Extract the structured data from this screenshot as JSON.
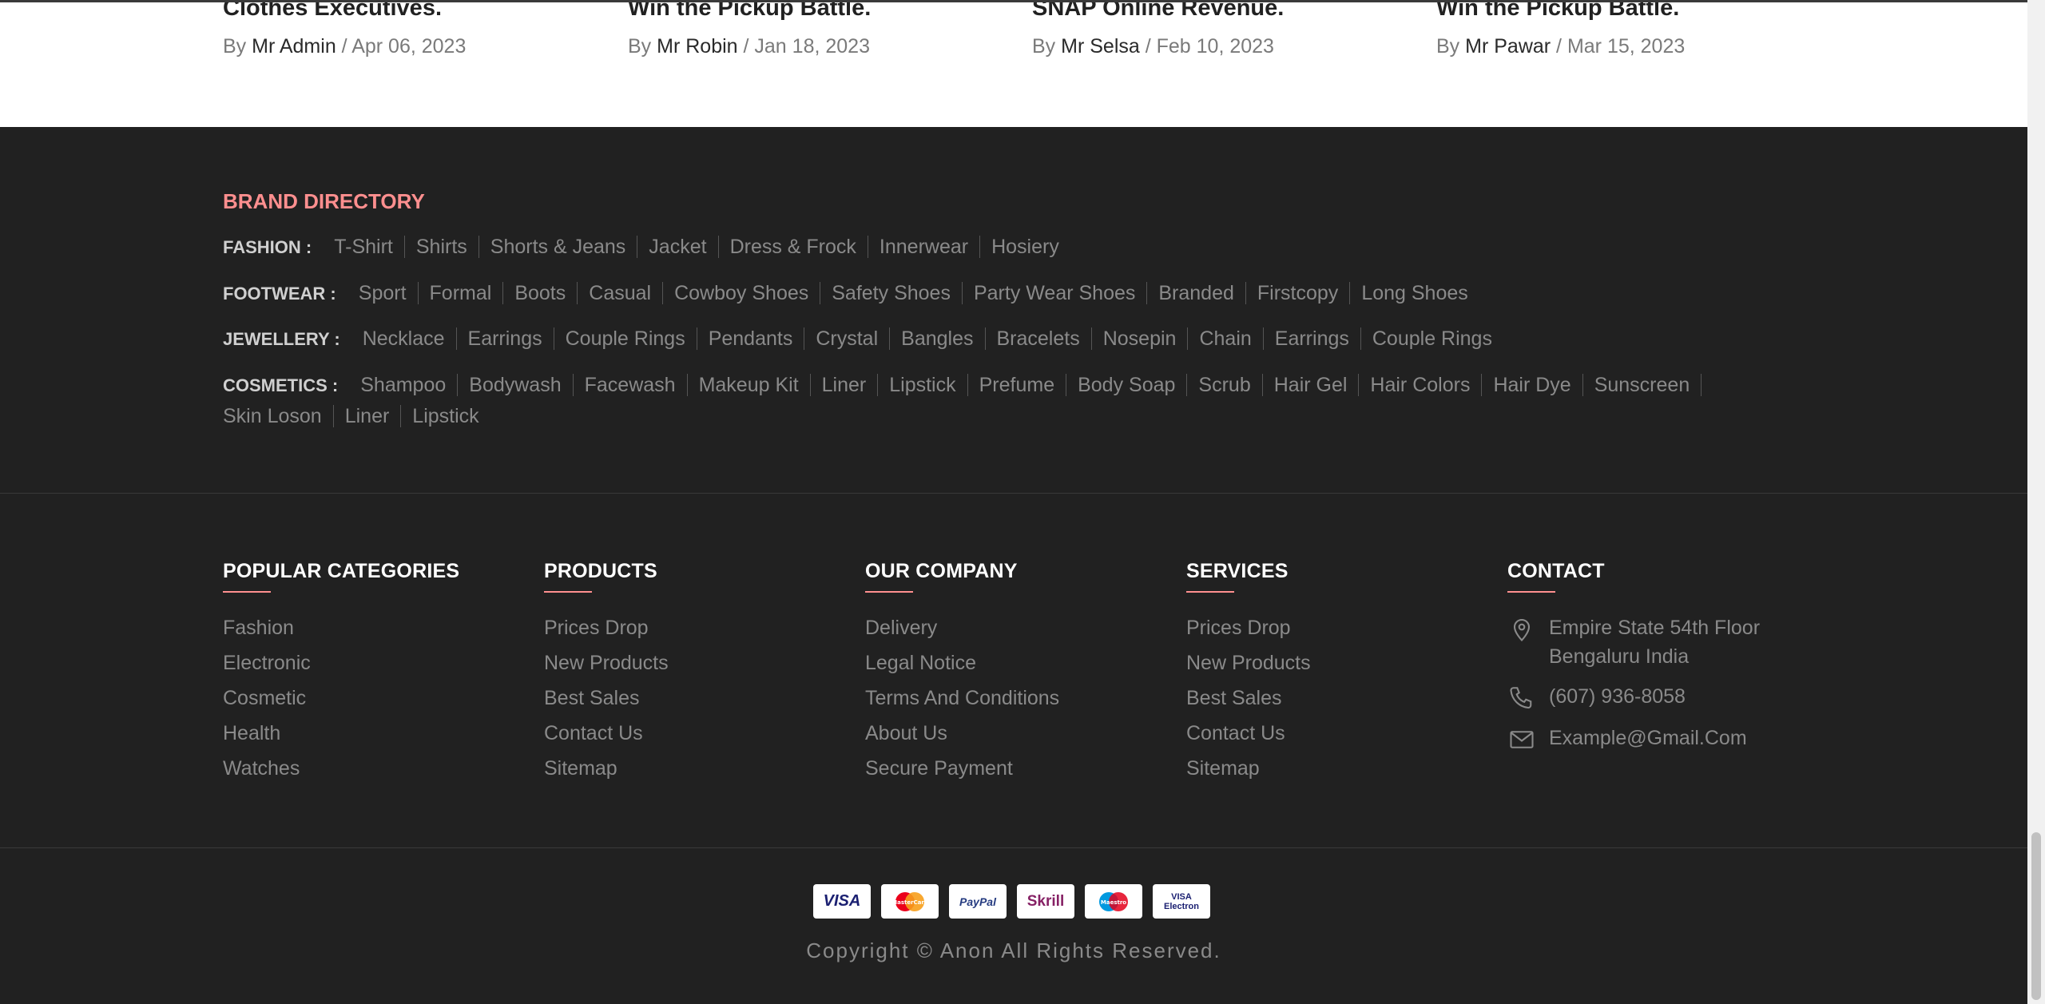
{
  "blog_posts": [
    {
      "title": "Clothes Executives.",
      "by": "By",
      "author": "Mr Admin",
      "date": "Apr 06, 2023"
    },
    {
      "title": "Win the Pickup Battle.",
      "by": "By",
      "author": "Mr Robin",
      "date": "Jan 18, 2023"
    },
    {
      "title": "SNAP Online Revenue.",
      "by": "By",
      "author": "Mr Selsa",
      "date": "Feb 10, 2023"
    },
    {
      "title": "Win the Pickup Battle.",
      "by": "By",
      "author": "Mr Pawar",
      "date": "Mar 15, 2023"
    }
  ],
  "brand_directory": {
    "title": "BRAND DIRECTORY",
    "rows": [
      {
        "category": "FASHION :",
        "links": [
          "T-Shirt",
          "Shirts",
          "Shorts & Jeans",
          "Jacket",
          "Dress & Frock",
          "Innerwear",
          "Hosiery"
        ]
      },
      {
        "category": "FOOTWEAR :",
        "links": [
          "Sport",
          "Formal",
          "Boots",
          "Casual",
          "Cowboy Shoes",
          "Safety Shoes",
          "Party Wear Shoes",
          "Branded",
          "Firstcopy",
          "Long Shoes"
        ]
      },
      {
        "category": "JEWELLERY :",
        "links": [
          "Necklace",
          "Earrings",
          "Couple Rings",
          "Pendants",
          "Crystal",
          "Bangles",
          "Bracelets",
          "Nosepin",
          "Chain",
          "Earrings",
          "Couple Rings"
        ]
      },
      {
        "category": "COSMETICS :",
        "links": [
          "Shampoo",
          "Bodywash",
          "Facewash",
          "Makeup Kit",
          "Liner",
          "Lipstick",
          "Prefume",
          "Body Soap",
          "Scrub",
          "Hair Gel",
          "Hair Colors",
          "Hair Dye",
          "Sunscreen"
        ]
      },
      {
        "category": "",
        "links": [
          "Skin Loson",
          "Liner",
          "Lipstick"
        ]
      }
    ]
  },
  "columns": [
    {
      "title": "POPULAR CATEGORIES",
      "links": [
        "Fashion",
        "Electronic",
        "Cosmetic",
        "Health",
        "Watches"
      ]
    },
    {
      "title": "PRODUCTS",
      "links": [
        "Prices Drop",
        "New Products",
        "Best Sales",
        "Contact Us",
        "Sitemap"
      ]
    },
    {
      "title": "OUR COMPANY",
      "links": [
        "Delivery",
        "Legal Notice",
        "Terms And Conditions",
        "About Us",
        "Secure Payment"
      ]
    },
    {
      "title": "SERVICES",
      "links": [
        "Prices Drop",
        "New Products",
        "Best Sales",
        "Contact Us",
        "Sitemap"
      ]
    }
  ],
  "contact": {
    "title": "CONTACT",
    "address": "Empire State 54th Floor Bengaluru India",
    "phone": "(607) 936-8058",
    "email": "Example@Gmail.Com",
    "icons": [
      "location-icon",
      "phone-icon",
      "mail-icon"
    ]
  },
  "payments": [
    "VISA",
    "MasterCard",
    "PayPal",
    "Skrill",
    "Maestro",
    "VISA Electron"
  ],
  "copyright": "Copyright © Anon All Rights Reserved.",
  "colors": {
    "footer_bg": "#212121",
    "accent": "#ff8f8f",
    "text_muted": "#8a8a8a",
    "heading": "#ffffff"
  }
}
